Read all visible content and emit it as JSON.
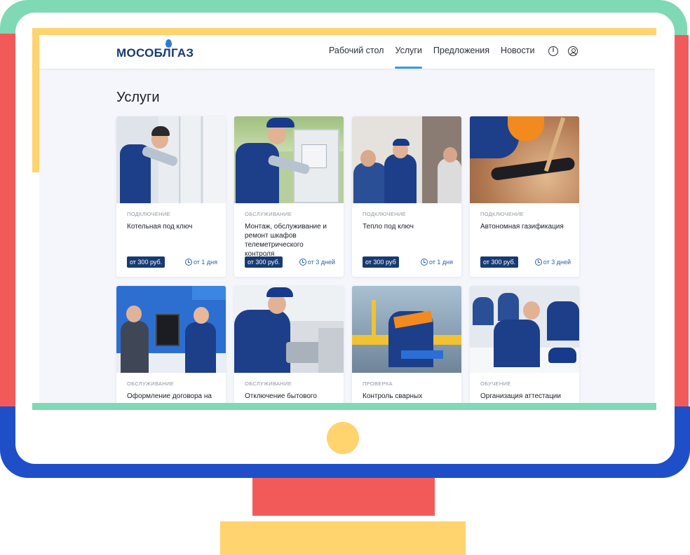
{
  "header": {
    "logo_text": "МОСОБЛГАЗ",
    "nav": [
      {
        "label": "Рабочий стол",
        "active": false
      },
      {
        "label": "Услуги",
        "active": true
      },
      {
        "label": "Предложения",
        "active": false
      },
      {
        "label": "Новости",
        "active": false
      }
    ],
    "icons": [
      "info-icon",
      "user-icon"
    ]
  },
  "page": {
    "title": "Услуги"
  },
  "services": [
    {
      "category": "Подключение",
      "title": "Котельная под ключ",
      "price": "от 300 руб.",
      "duration": "от 1 дня",
      "photo": "installer-at-boilers"
    },
    {
      "category": "Обслуживание",
      "title": "Монтаж, обслуживание и ремонт шкафов телеметрического контроля",
      "price": "от 300 руб.",
      "duration": "от 3 дней",
      "photo": "technician-at-meter-cabinet"
    },
    {
      "category": "Подключение",
      "title": "Тепло под ключ",
      "price": "от 300 руб",
      "duration": "от 1 дня",
      "photo": "technician-with-clients"
    },
    {
      "category": "Подключение",
      "title": "Автономная газификация",
      "price": "от 300 руб.",
      "duration": "от 3 дней",
      "photo": "pipe-in-trench"
    },
    {
      "category": "Обслуживание",
      "title": "Оформление договора на",
      "price": "",
      "duration": "",
      "photo": "contract-office"
    },
    {
      "category": "Обслуживание",
      "title": "Отключение бытового",
      "price": "",
      "duration": "",
      "photo": "technician-at-stove"
    },
    {
      "category": "Проверка",
      "title": "Контроль сварных",
      "price": "",
      "duration": "",
      "photo": "welder-at-work"
    },
    {
      "category": "Обучение",
      "title": "Организация аттестации",
      "price": "",
      "duration": "",
      "photo": "training-class"
    }
  ],
  "colors": {
    "brand": "#173a72",
    "accent": "#3a97e8",
    "frame_green": "#7fd9b4",
    "frame_red": "#f25a5a",
    "frame_blue": "#1f4ec9",
    "frame_yellow": "#ffd36e"
  }
}
